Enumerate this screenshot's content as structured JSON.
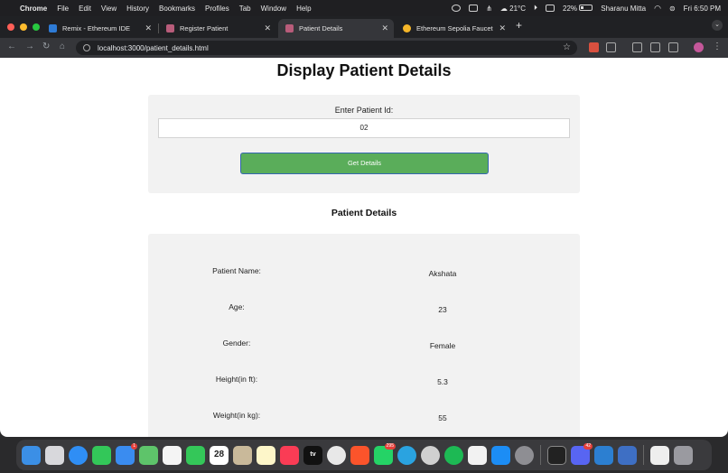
{
  "menubar": {
    "app": "Chrome",
    "items": [
      "File",
      "Edit",
      "View",
      "History",
      "Bookmarks",
      "Profiles",
      "Tab",
      "Window",
      "Help"
    ],
    "weather": "21°C",
    "battery": "22%",
    "user": "Sharanu Mitta",
    "datetime": "Fri 6:50 PM"
  },
  "tabs": [
    {
      "title": "Remix - Ethereum IDE",
      "favicon": "remix-icon",
      "color": "#2e7bd6"
    },
    {
      "title": "Register Patient",
      "favicon": "page-icon",
      "color": "#b85c7a"
    },
    {
      "title": "Patient Details",
      "favicon": "page-icon",
      "color": "#b85c7a"
    },
    {
      "title": "Ethereum Sepolia Faucet",
      "favicon": "faucet-icon",
      "color": "#f5b629"
    }
  ],
  "toolbar": {
    "url": "localhost:3000/patient_details.html"
  },
  "page": {
    "title": "Display Patient Details",
    "id_label": "Enter Patient Id:",
    "id_value": "02",
    "button_label": "Get Details",
    "section_title": "Patient Details",
    "details": [
      {
        "label": "Patient Name:",
        "value": "Akshata"
      },
      {
        "label": "Age:",
        "value": "23"
      },
      {
        "label": "Gender:",
        "value": "Female"
      },
      {
        "label": "Height(in ft):",
        "value": "5.3"
      },
      {
        "label": "Weight(in kg):",
        "value": "55"
      }
    ]
  },
  "dock": {
    "calendar_day": "28",
    "tv_label": "tv",
    "mail_badge": "1",
    "whatsapp_badge": "295",
    "discord_badge": "42"
  },
  "colors": {
    "button_green": "#5aad5a",
    "button_border": "#3466b0",
    "card_bg": "#f2f2f2"
  }
}
